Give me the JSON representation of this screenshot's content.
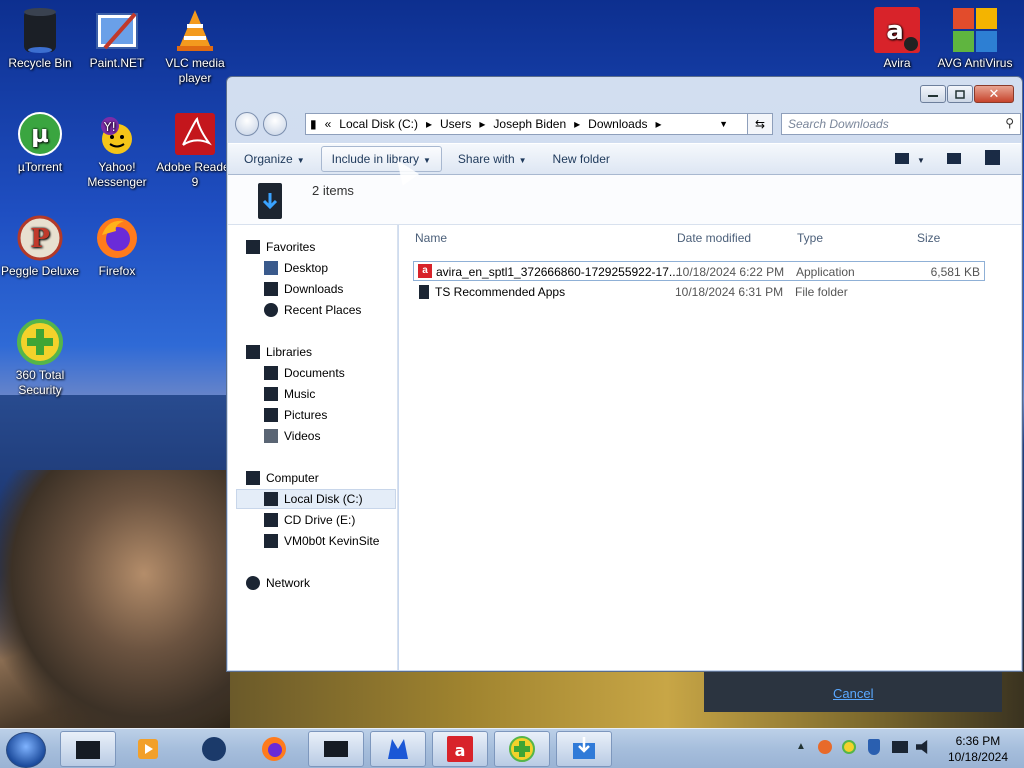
{
  "desktop": {
    "icons": [
      {
        "label": "Recycle Bin",
        "icon": "recycle-bin-icon"
      },
      {
        "label": "Paint.NET",
        "icon": "paint-net-icon"
      },
      {
        "label": "VLC media player",
        "icon": "vlc-icon"
      },
      {
        "label": "µTorrent",
        "icon": "utorrent-icon"
      },
      {
        "label": "Yahoo! Messenger",
        "icon": "yahoo-messenger-icon"
      },
      {
        "label": "Adobe Reader 9",
        "icon": "adobe-reader-icon"
      },
      {
        "label": "Peggle Deluxe",
        "icon": "peggle-icon"
      },
      {
        "label": "Firefox",
        "icon": "firefox-icon"
      },
      {
        "label": "360 Total Security",
        "icon": "360-security-icon"
      },
      {
        "label": "Avira",
        "icon": "avira-icon"
      },
      {
        "label": "AVG AntiVirus",
        "icon": "avg-icon"
      }
    ]
  },
  "explorer": {
    "breadcrumb": [
      "Local Disk (C:)",
      "Users",
      "Joseph Biden",
      "Downloads"
    ],
    "breadcrumb_prefix": "«",
    "search_placeholder": "Search Downloads",
    "toolbar": {
      "organize": "Organize",
      "include_in_library": "Include in library",
      "share_with": "Share with",
      "new_folder": "New folder"
    },
    "details": {
      "count": "2 items"
    },
    "nav": {
      "favorites": "Favorites",
      "desktop": "Desktop",
      "downloads": "Downloads",
      "recent_places": "Recent Places",
      "libraries": "Libraries",
      "documents": "Documents",
      "music": "Music",
      "pictures": "Pictures",
      "videos": "Videos",
      "computer": "Computer",
      "local_disk": "Local Disk (C:)",
      "cd_drive": "CD Drive (E:)",
      "vm_site": "VM0b0t KevinSite",
      "network": "Network"
    },
    "columns": {
      "name": "Name",
      "date": "Date modified",
      "type": "Type",
      "size": "Size"
    },
    "files": [
      {
        "name": "avira_en_sptl1_372666860-1729255922-17...",
        "date": "10/18/2024 6:22 PM",
        "type": "Application",
        "size": "6,581 KB"
      },
      {
        "name": "TS Recommended Apps",
        "date": "10/18/2024 6:31 PM",
        "type": "File folder",
        "size": ""
      }
    ]
  },
  "download_panel": {
    "cancel": "Cancel"
  },
  "taskbar": {
    "time": "6:36 PM",
    "date": "10/18/2024"
  },
  "colors": {
    "accent": "#1e395b",
    "avira_red": "#d8232a"
  }
}
